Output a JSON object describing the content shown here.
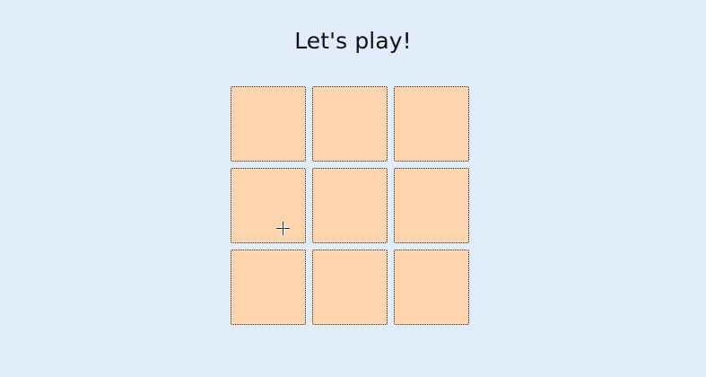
{
  "title": "Let's play!",
  "board": {
    "cells": [
      "",
      "",
      "",
      "",
      "",
      "",
      "",
      "",
      ""
    ]
  },
  "colors": {
    "background": "#e1edfb",
    "cell": "#ffd5b0",
    "cell_border": "#2a2a2a"
  },
  "cursor": "crosshair-cursor-icon"
}
